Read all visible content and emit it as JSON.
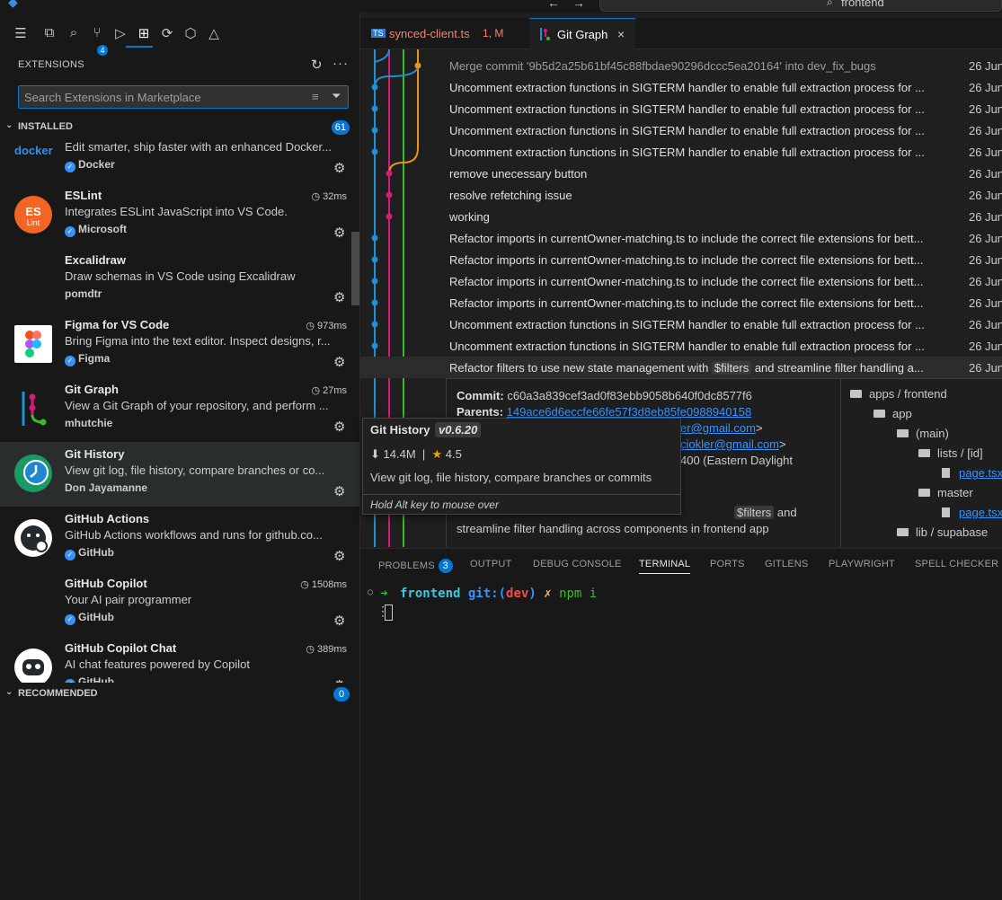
{
  "titlebar": {
    "search_text": "frontend"
  },
  "activity_bar": {
    "source_control_badge": "4"
  },
  "sidebar": {
    "title": "EXTENSIONS",
    "search_placeholder": "Search Extensions in Marketplace",
    "installed": {
      "label": "INSTALLED",
      "count": "61"
    },
    "recommended": {
      "label": "RECOMMENDED",
      "count": "0"
    },
    "extensions": [
      {
        "name": "",
        "desc": "Edit smarter, ship faster with an enhanced Docker...",
        "publisher": "Docker",
        "time": "",
        "verified": true
      },
      {
        "name": "ESLint",
        "desc": "Integrates ESLint JavaScript into VS Code.",
        "publisher": "Microsoft",
        "time": "32ms",
        "verified": true
      },
      {
        "name": "Excalidraw",
        "desc": "Draw schemas in VS Code using Excalidraw",
        "publisher": "pomdtr",
        "time": "",
        "verified": false
      },
      {
        "name": "Figma for VS Code",
        "desc": "Bring Figma into the text editor. Inspect designs, r...",
        "publisher": "Figma",
        "time": "973ms",
        "verified": true
      },
      {
        "name": "Git Graph",
        "desc": "View a Git Graph of your repository, and perform ...",
        "publisher": "mhutchie",
        "time": "27ms",
        "verified": false
      },
      {
        "name": "Git History",
        "desc": "View git log, file history, compare branches or co...",
        "publisher": "Don Jayamanne",
        "time": "",
        "verified": false
      },
      {
        "name": "GitHub Actions",
        "desc": "GitHub Actions workflows and runs for github.co...",
        "publisher": "GitHub",
        "time": "",
        "verified": true
      },
      {
        "name": "GitHub Copilot",
        "desc": "Your AI pair programmer",
        "publisher": "GitHub",
        "time": "1508ms",
        "verified": true
      },
      {
        "name": "GitHub Copilot Chat",
        "desc": "AI chat features powered by Copilot",
        "publisher": "GitHub",
        "time": "389ms",
        "verified": true
      }
    ]
  },
  "tabs": [
    {
      "label": "synced-client.ts",
      "status": "1, M"
    },
    {
      "label": "Git Graph"
    }
  ],
  "graph": {
    "commits": [
      {
        "msg": "Merge commit '9b5d2a25b61bf45c88fbdae90296dccc5ea20164' into dev_fix_bugs",
        "date": "26 Jun"
      },
      {
        "msg": "Uncomment extraction functions in SIGTERM handler to enable full extraction process for ...",
        "date": "26 Jun"
      },
      {
        "msg": "Uncomment extraction functions in SIGTERM handler to enable full extraction process for ...",
        "date": "26 Jun"
      },
      {
        "msg": "Uncomment extraction functions in SIGTERM handler to enable full extraction process for ...",
        "date": "26 Jun"
      },
      {
        "msg": "Uncomment extraction functions in SIGTERM handler to enable full extraction process for ...",
        "date": "26 Jun"
      },
      {
        "msg": "remove unecessary button",
        "date": "26 Jun"
      },
      {
        "msg": "resolve refetching issue",
        "date": "26 Jun"
      },
      {
        "msg": "working",
        "date": "26 Jun"
      },
      {
        "msg": "Refactor imports in currentOwner-matching.ts to include the correct file extensions for bett...",
        "date": "26 Jun"
      },
      {
        "msg": "Refactor imports in currentOwner-matching.ts to include the correct file extensions for bett...",
        "date": "26 Jun"
      },
      {
        "msg": "Refactor imports in currentOwner-matching.ts to include the correct file extensions for bett...",
        "date": "26 Jun"
      },
      {
        "msg": "Refactor imports in currentOwner-matching.ts to include the correct file extensions for bett...",
        "date": "26 Jun"
      },
      {
        "msg": "Uncomment extraction functions in SIGTERM handler to enable full extraction process for ...",
        "date": "26 Jun"
      },
      {
        "msg": "Uncomment extraction functions in SIGTERM handler to enable full extraction process for ...",
        "date": "26 Jun"
      }
    ],
    "selected": {
      "msg_pre": "Refactor filters to use new state management with ",
      "msg_code": "$filters",
      "msg_post": " and streamline filter handling a...",
      "date": "26 Jun"
    },
    "details": {
      "commit_label": "Commit:",
      "commit_hash": "c60a3a839cef3ad0f83ebb9058b640f0dc8577f6",
      "parents_label": "Parents:",
      "parents_hash": "149ace6d6eccfe66fe57f3d8eb85fe0988940158",
      "author_email_fragment": "er@gmail.com",
      "committer_email_fragment": "ciokler@gmail.com",
      "date_fragment": "400 (Eastern Daylight",
      "body_line1_code": "$filters",
      "body_line1_post": " and",
      "body_line2": "streamline filter handling across components in frontend app"
    },
    "tree": [
      {
        "label": "apps / frontend",
        "kind": "folder"
      },
      {
        "label": "app",
        "kind": "folder"
      },
      {
        "label": "(main)",
        "kind": "folder"
      },
      {
        "label": "lists / [id]",
        "kind": "folder"
      },
      {
        "label": "page.tsx",
        "kind": "file"
      },
      {
        "label": "master",
        "kind": "folder"
      },
      {
        "label": "page.tsx",
        "kind": "file"
      },
      {
        "label": "lib / supabase",
        "kind": "folder"
      }
    ]
  },
  "tooltip": {
    "title": "Git History",
    "version": "v0.6.20",
    "installs": "14.4M",
    "rating": "4.5",
    "description": "View git log, file history, compare branches or commits",
    "hint": "Hold Alt key to mouse over"
  },
  "panel": {
    "tabs": [
      {
        "label": "PROBLEMS",
        "badge": "3"
      },
      {
        "label": "OUTPUT"
      },
      {
        "label": "DEBUG CONSOLE"
      },
      {
        "label": "TERMINAL"
      },
      {
        "label": "PORTS"
      },
      {
        "label": "GITLENS"
      },
      {
        "label": "PLAYWRIGHT"
      },
      {
        "label": "SPELL CHECKER"
      }
    ],
    "terminal": {
      "dir": "frontend",
      "git_prefix": "git:(",
      "branch": "dev",
      "git_suffix": ")",
      "dirty_mark": "✗",
      "command": "npm i"
    }
  },
  "colors": {
    "accent": "#0078d4",
    "link": "#3794ff",
    "lane_blue": "#1e90d4",
    "lane_pink": "#d6197c",
    "lane_green": "#3cba2f",
    "lane_orange": "#e8951c"
  }
}
